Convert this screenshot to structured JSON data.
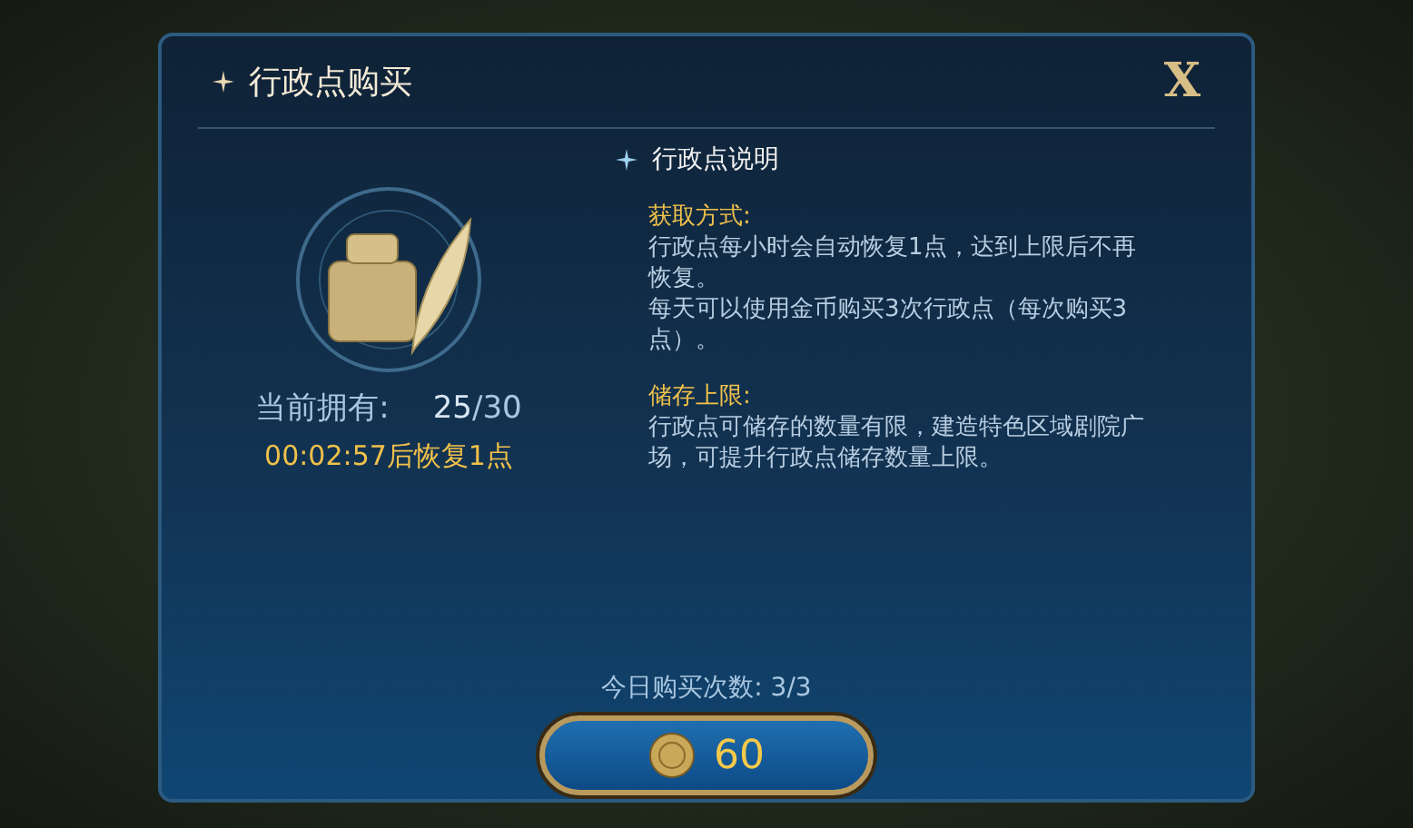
{
  "dialog": {
    "title": "行政点购买",
    "close": "X"
  },
  "item": {
    "owned_label": "当前拥有:",
    "owned_value": "25",
    "owned_max": "/30",
    "recovery": "00:02:57后恢复1点"
  },
  "info": {
    "heading": "行政点说明",
    "sections": [
      {
        "title": "获取方式:",
        "paragraphs": [
          "行政点每小时会自动恢复1点，达到上限后不再恢复。",
          "每天可以使用金币购买3次行政点（每次购买3点）。"
        ]
      },
      {
        "title": "储存上限:",
        "paragraphs": [
          "行政点可储存的数量有限，建造特色区域剧院广场，可提升行政点储存数量上限。"
        ]
      }
    ]
  },
  "purchase": {
    "count_label": "今日购买次数: 3/3",
    "price": "60"
  }
}
